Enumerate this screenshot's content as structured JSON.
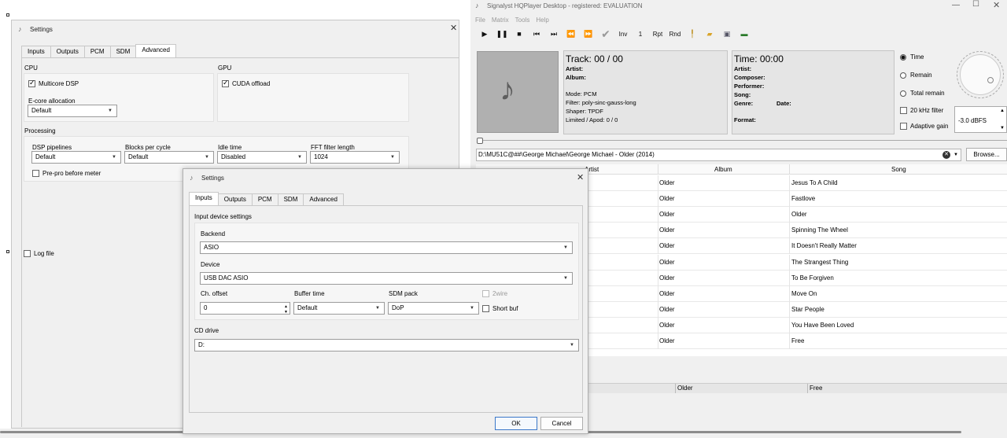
{
  "hqp": {
    "title": "Signalyst HQPlayer Desktop - registered: EVALUATION",
    "menu": [
      "File",
      "Matrix",
      "Tools",
      "Help"
    ],
    "toolbar": {
      "inv": "Inv",
      "one": "1",
      "rpt": "Rpt",
      "rnd": "Rnd"
    },
    "track": {
      "heading": "Track: 00 / 00",
      "artist": "Artist:",
      "album": "Album:",
      "mode": "Mode: PCM",
      "filter": "Filter: poly-sinc-gauss-long",
      "shaper": "Shaper: TPDF",
      "limited": "Limited / Apod: 0 / 0"
    },
    "time": {
      "heading": "Time: 00:00",
      "artist": "Artist:",
      "composer": "Composer:",
      "performer": "Performer:",
      "song": "Song:",
      "genre": "Genre:",
      "date": "Date:",
      "format": "Format:"
    },
    "options": {
      "time": "Time",
      "remain": "Remain",
      "total_remain": "Total remain",
      "khz20": "20 kHz filter",
      "adaptive": "Adaptive gain",
      "gain": "-3.0 dBFS"
    },
    "path": "D:\\MU51C@##\\George Michael\\George Michael - Older (2014)",
    "browse": "Browse...",
    "columns": {
      "artist": "Artist",
      "album": "Album",
      "song": "Song"
    },
    "rows": [
      {
        "album": "Older",
        "song": "Jesus To A Child"
      },
      {
        "album": "Older",
        "song": "Fastlove"
      },
      {
        "album": "Older",
        "song": "Older"
      },
      {
        "album": "Older",
        "song": "Spinning The Wheel"
      },
      {
        "album": "Older",
        "song": "It Doesn't Really Matter"
      },
      {
        "album": "Older",
        "song": "The Strangest Thing"
      },
      {
        "album": "Older",
        "song": "To Be Forgiven"
      },
      {
        "album": "Older",
        "song": "Move On"
      },
      {
        "album": "Older",
        "song": "Star People"
      },
      {
        "album": "Older",
        "song": "You Have Been Loved"
      },
      {
        "album": "Older",
        "song": "Free"
      }
    ],
    "bottom_row": {
      "album": "Older",
      "song": "Free"
    }
  },
  "settings_back": {
    "title": "Settings",
    "tabs": [
      "Inputs",
      "Outputs",
      "PCM",
      "SDM",
      "Advanced"
    ],
    "cpu_label": "CPU",
    "multicore": "Multicore DSP",
    "ecore_label": "E-core allocation",
    "ecore_value": "Default",
    "gpu_label": "GPU",
    "cuda": "CUDA offload",
    "processing_label": "Processing",
    "dsp_label": "DSP pipelines",
    "dsp_value": "Default",
    "blocks_label": "Blocks per cycle",
    "blocks_value": "Default",
    "idle_label": "Idle time",
    "idle_value": "Disabled",
    "fft_label": "FFT filter length",
    "fft_value": "1024",
    "prepro": "Pre-pro before meter",
    "logfile": "Log file"
  },
  "settings_front": {
    "title": "Settings",
    "tabs": [
      "Inputs",
      "Outputs",
      "PCM",
      "SDM",
      "Advanced"
    ],
    "section": "Input device settings",
    "backend_label": "Backend",
    "backend_value": "ASIO",
    "device_label": "Device",
    "device_value": "USB DAC ASIO",
    "choffset_label": "Ch. offset",
    "choffset_value": "0",
    "buffer_label": "Buffer time",
    "buffer_value": "Default",
    "sdmpack_label": "SDM pack",
    "sdmpack_value": "DoP",
    "twowire": "2wire",
    "shortbuf": "Short buf",
    "cd_label": "CD drive",
    "cd_value": "D:",
    "ok": "OK",
    "cancel": "Cancel"
  }
}
